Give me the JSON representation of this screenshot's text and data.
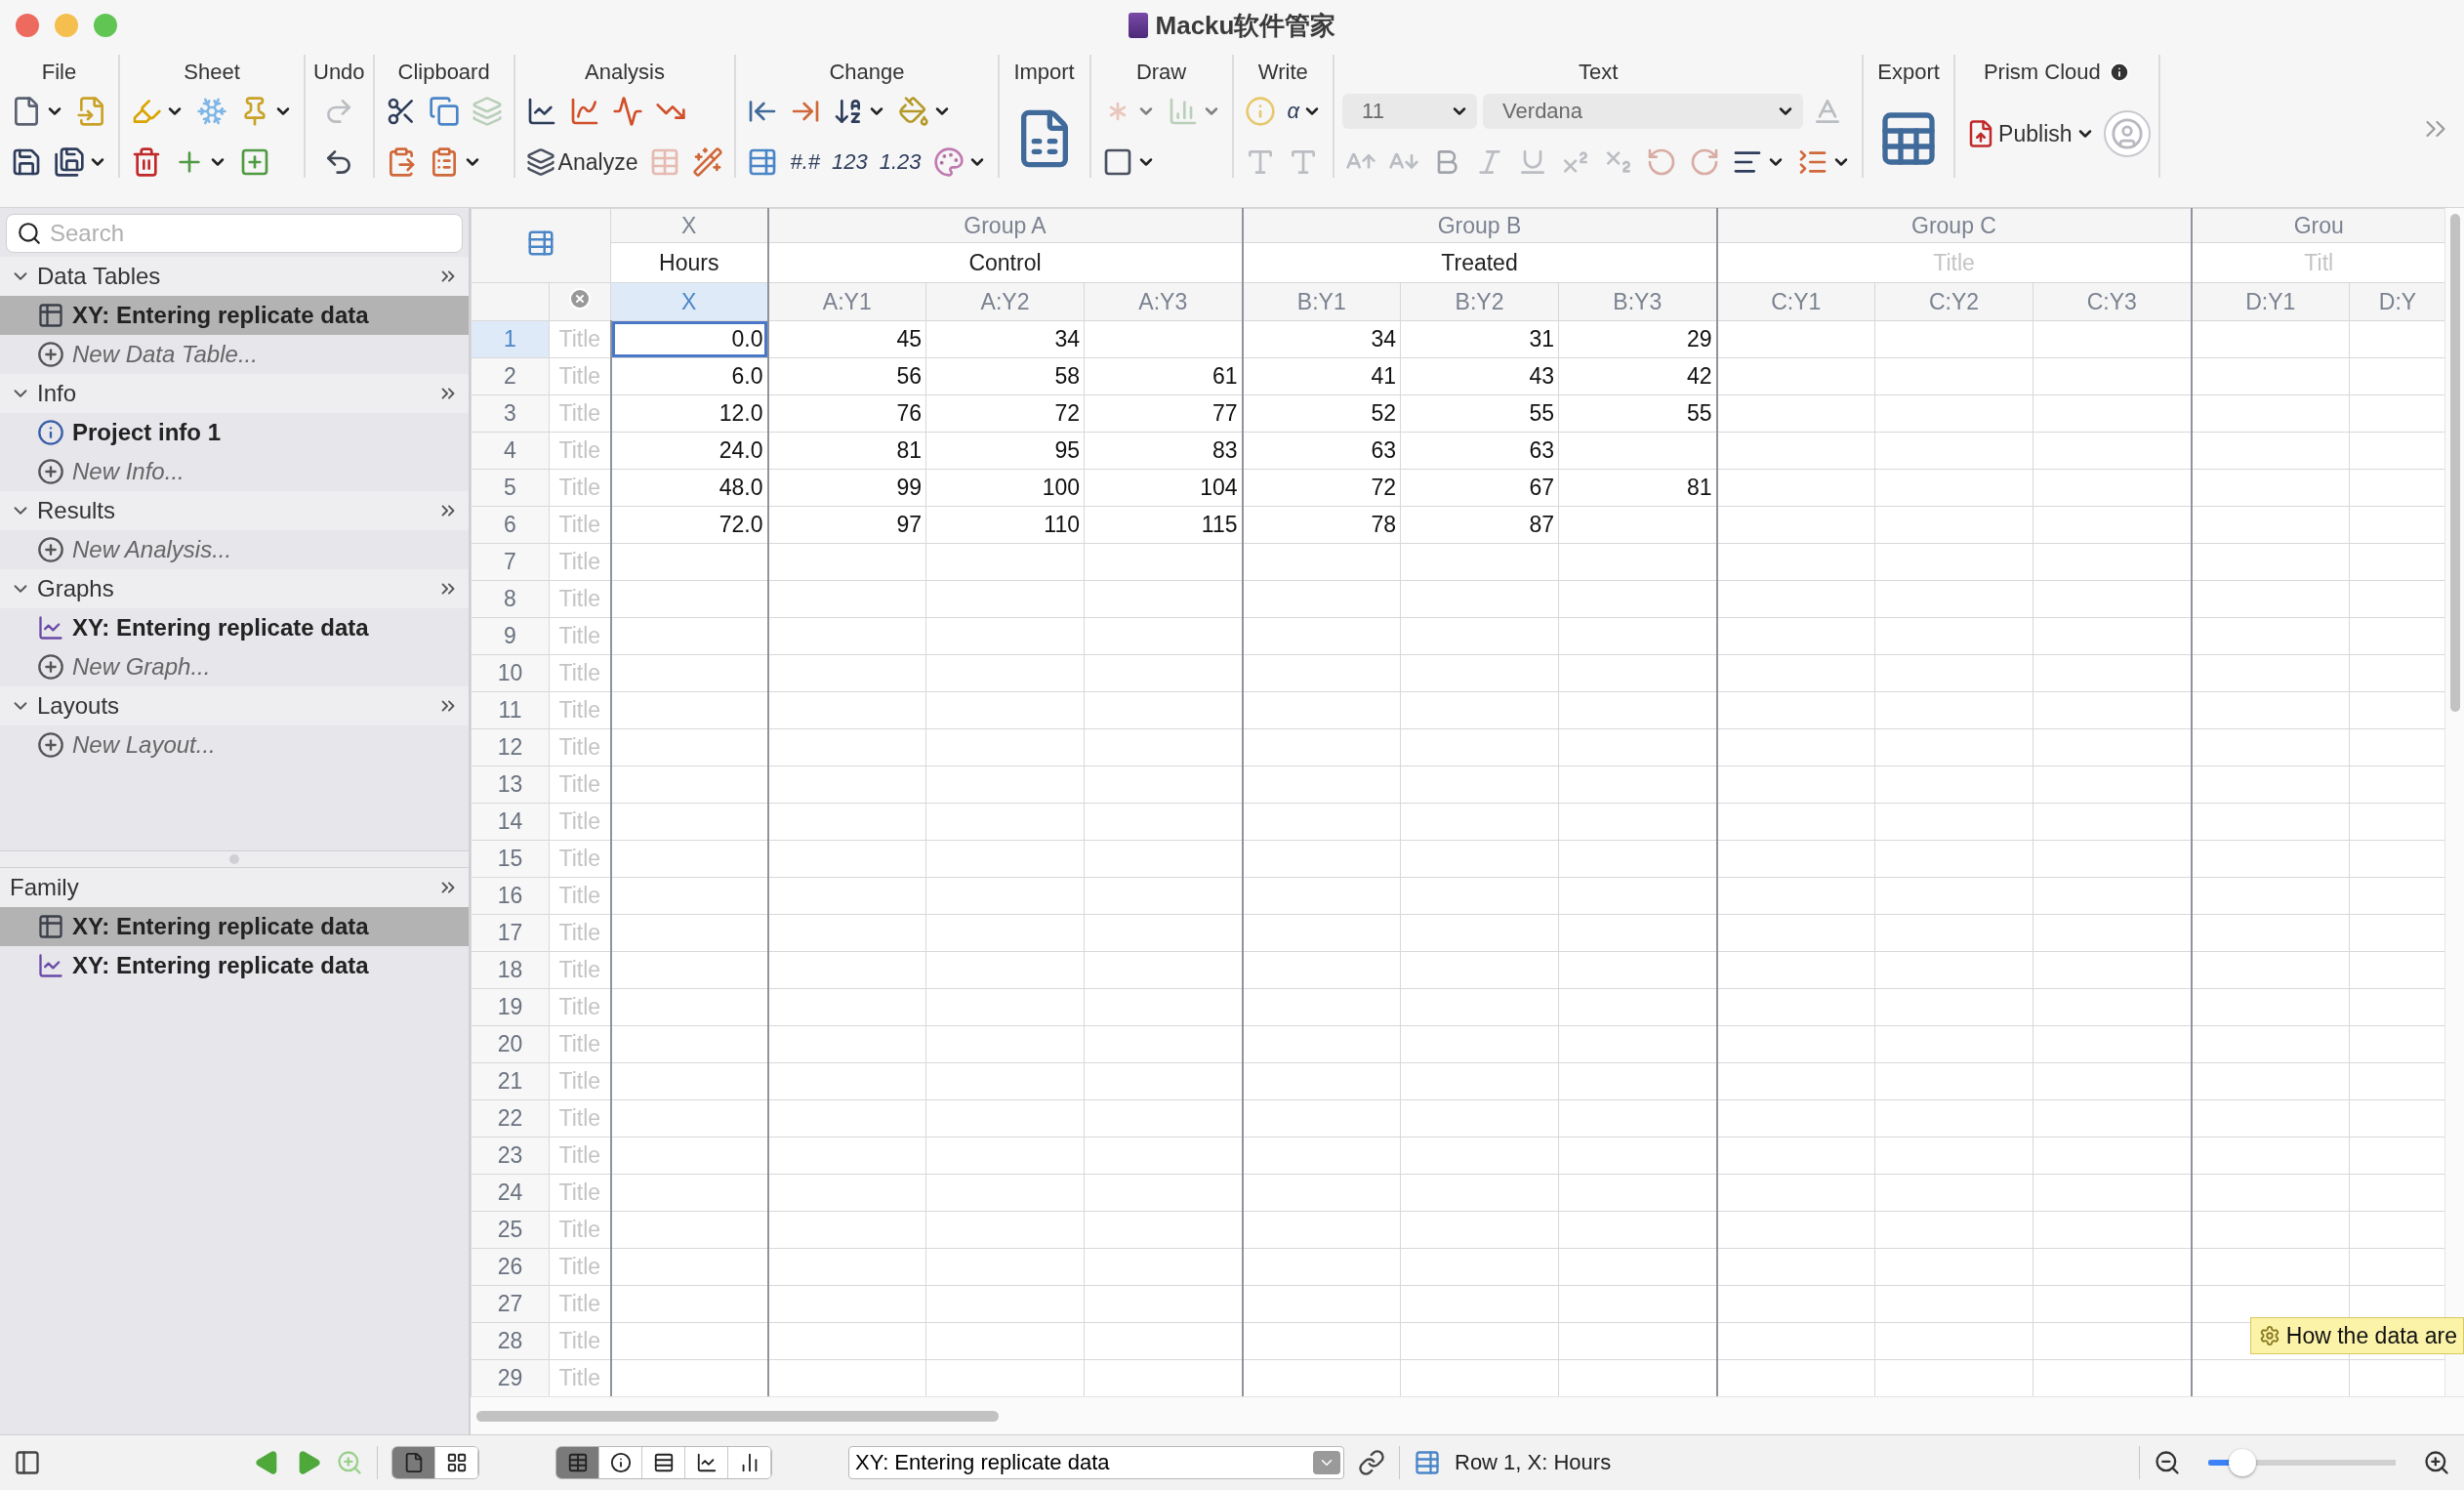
{
  "window": {
    "title": "Macku软件管家"
  },
  "toolbar": {
    "groups": [
      {
        "label": "File",
        "rows": [
          [
            {
              "kind": "icon",
              "dropdown": true,
              "disabled": false
            },
            {
              "kind": "icon",
              "dropdown": false,
              "disabled": false
            }
          ],
          [
            {
              "kind": "icon",
              "dropdown": false,
              "disabled": false
            },
            {
              "kind": "icon",
              "dropdown": true,
              "disabled": false
            }
          ]
        ]
      },
      {
        "label": "Sheet",
        "rows": [
          [
            {
              "kind": "icon",
              "dropdown": true,
              "disabled": false
            },
            {
              "kind": "icon",
              "dropdown": false,
              "disabled": false
            },
            {
              "kind": "icon",
              "dropdown": true,
              "disabled": false
            }
          ],
          [
            {
              "kind": "icon",
              "dropdown": false,
              "disabled": false
            },
            {
              "kind": "icon",
              "dropdown": true,
              "disabled": false
            },
            {
              "kind": "icon",
              "dropdown": false,
              "disabled": false
            }
          ]
        ]
      },
      {
        "label": "Undo",
        "rows": [
          [
            {
              "kind": "icon",
              "dropdown": false,
              "disabled": true
            }
          ],
          [
            {
              "kind": "icon",
              "dropdown": false,
              "disabled": false
            }
          ]
        ]
      },
      {
        "label": "Clipboard",
        "rows": [
          [
            {
              "kind": "icon",
              "dropdown": false,
              "disabled": false
            },
            {
              "kind": "icon",
              "dropdown": false,
              "disabled": false
            },
            {
              "kind": "icon",
              "dropdown": false,
              "disabled": true
            }
          ],
          [
            {
              "kind": "icon",
              "dropdown": false,
              "disabled": false
            },
            {
              "kind": "icon",
              "dropdown": true,
              "disabled": false
            }
          ]
        ]
      },
      {
        "label": "Analysis",
        "rows": [
          [
            {
              "kind": "icon",
              "dropdown": false,
              "disabled": false
            },
            {
              "kind": "icon",
              "dropdown": false,
              "disabled": false
            },
            {
              "kind": "icon",
              "dropdown": false,
              "disabled": false
            },
            {
              "kind": "icon",
              "dropdown": false,
              "disabled": false
            }
          ],
          [
            {
              "kind": "labeled",
              "text": "Analyze",
              "dropdown": false,
              "disabled": false
            },
            {
              "kind": "icon",
              "dropdown": false,
              "disabled": true
            },
            {
              "kind": "icon",
              "dropdown": false,
              "disabled": false
            }
          ]
        ]
      },
      {
        "label": "Change",
        "rows": [
          [
            {
              "kind": "icon",
              "dropdown": false,
              "disabled": false
            },
            {
              "kind": "icon",
              "dropdown": false,
              "disabled": false
            },
            {
              "kind": "icon",
              "dropdown": true,
              "disabled": false
            },
            {
              "kind": "icon",
              "dropdown": true,
              "disabled": false
            }
          ],
          [
            {
              "kind": "icon",
              "dropdown": false,
              "disabled": false
            },
            {
              "kind": "glyph",
              "text": "#.#",
              "dropdown": false,
              "disabled": false
            },
            {
              "kind": "glyph",
              "text": "123",
              "dropdown": false,
              "disabled": false
            },
            {
              "kind": "glyph",
              "text": "1.23",
              "dropdown": false,
              "disabled": false
            },
            {
              "kind": "icon",
              "dropdown": true,
              "disabled": false
            }
          ]
        ]
      },
      {
        "label": "Import",
        "rows": [
          [
            {
              "kind": "large",
              "dropdown": false,
              "disabled": false
            }
          ]
        ]
      },
      {
        "label": "Draw",
        "rows": [
          [
            {
              "kind": "icon",
              "dropdown": true,
              "disabled": true
            },
            {
              "kind": "icon",
              "dropdown": true,
              "disabled": true
            }
          ],
          [
            {
              "kind": "icon",
              "dropdown": true,
              "disabled": false
            }
          ]
        ]
      },
      {
        "label": "Write",
        "rows": [
          [
            {
              "kind": "icon",
              "dropdown": false,
              "disabled": true
            },
            {
              "kind": "glyph",
              "text": "α",
              "dropdown": true,
              "disabled": false
            }
          ],
          [
            {
              "kind": "icon",
              "dropdown": false,
              "disabled": true
            },
            {
              "kind": "icon",
              "dropdown": false,
              "disabled": true
            }
          ]
        ]
      },
      {
        "label": "Text",
        "rows": [
          [
            {
              "kind": "select",
              "text": "11",
              "dropdown": true,
              "disabled": true
            },
            {
              "kind": "select",
              "text": "Verdana",
              "dropdown": true,
              "disabled": true
            },
            {
              "kind": "icon",
              "dropdown": false,
              "disabled": true
            }
          ],
          [
            {
              "kind": "icon",
              "dropdown": false,
              "disabled": true
            },
            {
              "kind": "icon",
              "dropdown": false,
              "disabled": true
            },
            {
              "kind": "icon",
              "dropdown": false,
              "disabled": true
            },
            {
              "kind": "icon",
              "dropdown": false,
              "disabled": true
            },
            {
              "kind": "icon",
              "dropdown": false,
              "disabled": true
            },
            {
              "kind": "icon",
              "dropdown": false,
              "disabled": true
            },
            {
              "kind": "icon",
              "dropdown": false,
              "disabled": true
            },
            {
              "kind": "icon",
              "dropdown": false,
              "disabled": true
            },
            {
              "kind": "icon",
              "dropdown": false,
              "disabled": true
            },
            {
              "kind": "icon",
              "dropdown": true,
              "disabled": false
            },
            {
              "kind": "icon",
              "dropdown": true,
              "disabled": false
            }
          ]
        ]
      },
      {
        "label": "Export",
        "rows": [
          [
            {
              "kind": "large",
              "dropdown": false,
              "disabled": false
            }
          ]
        ]
      },
      {
        "label": "Prism Cloud",
        "rows": [
          [
            {
              "kind": "labeled",
              "text": "Publish",
              "dropdown": true,
              "disabled": false
            },
            {
              "kind": "avatar",
              "dropdown": false,
              "disabled": false
            }
          ]
        ]
      }
    ]
  },
  "sidebar": {
    "search": {
      "placeholder": "Search"
    },
    "sections": [
      {
        "title": "Data Tables",
        "expanded": true,
        "items": [
          {
            "kind": "table",
            "label": "XY: Entering replicate data",
            "selected": true
          },
          {
            "kind": "new",
            "label": "New Data Table...",
            "selected": false
          }
        ]
      },
      {
        "title": "Info",
        "expanded": true,
        "items": [
          {
            "kind": "info",
            "label": "Project info 1",
            "selected": false
          },
          {
            "kind": "new",
            "label": "New Info...",
            "selected": false
          }
        ]
      },
      {
        "title": "Results",
        "expanded": true,
        "items": [
          {
            "kind": "new",
            "label": "New Analysis...",
            "selected": false
          }
        ]
      },
      {
        "title": "Graphs",
        "expanded": true,
        "items": [
          {
            "kind": "graph",
            "label": "XY: Entering replicate data",
            "selected": false
          },
          {
            "kind": "new",
            "label": "New Graph...",
            "selected": false
          }
        ]
      },
      {
        "title": "Layouts",
        "expanded": true,
        "items": [
          {
            "kind": "new",
            "label": "New Layout...",
            "selected": false
          }
        ]
      }
    ],
    "family": {
      "title": "Family",
      "items": [
        {
          "kind": "table",
          "label": "XY: Entering replicate data",
          "selected": true
        },
        {
          "kind": "graph",
          "label": "XY: Entering replicate data",
          "selected": false
        }
      ]
    }
  },
  "table": {
    "groups": [
      {
        "title": "X",
        "subtitle": "Hours",
        "columns": [
          {
            "label": "X",
            "selected": true
          }
        ]
      },
      {
        "title": "Group A",
        "subtitle": "Control",
        "columns": [
          {
            "label": "A:Y1",
            "selected": false
          },
          {
            "label": "A:Y2",
            "selected": false
          },
          {
            "label": "A:Y3",
            "selected": false
          }
        ]
      },
      {
        "title": "Group B",
        "subtitle": "Treated",
        "columns": [
          {
            "label": "B:Y1",
            "selected": false
          },
          {
            "label": "B:Y2",
            "selected": false
          },
          {
            "label": "B:Y3",
            "selected": false
          }
        ]
      },
      {
        "title": "Group C",
        "subtitle_placeholder": "Title",
        "columns": [
          {
            "label": "C:Y1",
            "selected": false
          },
          {
            "label": "C:Y2",
            "selected": false
          },
          {
            "label": "C:Y3",
            "selected": false
          }
        ]
      },
      {
        "title": "Grou",
        "subtitle_placeholder": "Titl",
        "columns": [
          {
            "label": "D:Y1",
            "selected": false
          },
          {
            "label": "D:Y",
            "selected": false
          }
        ]
      }
    ],
    "rows": [
      {
        "number": "1",
        "title_placeholder": "Title",
        "selected": true,
        "cells": [
          "0.0",
          "45",
          "34",
          null,
          "34",
          "31",
          "29"
        ]
      },
      {
        "number": "2",
        "title_placeholder": "Title",
        "selected": false,
        "cells": [
          "6.0",
          "56",
          "58",
          "61",
          "41",
          "43",
          "42"
        ]
      },
      {
        "number": "3",
        "title_placeholder": "Title",
        "selected": false,
        "cells": [
          "12.0",
          "76",
          "72",
          "77",
          "52",
          "55",
          "55"
        ]
      },
      {
        "number": "4",
        "title_placeholder": "Title",
        "selected": false,
        "cells": [
          "24.0",
          "81",
          "95",
          "83",
          "63",
          "63"
        ]
      },
      {
        "number": "5",
        "title_placeholder": "Title",
        "selected": false,
        "cells": [
          "48.0",
          "99",
          "100",
          "104",
          "72",
          "67",
          "81"
        ]
      },
      {
        "number": "6",
        "title_placeholder": "Title",
        "selected": false,
        "cells": [
          "72.0",
          "97",
          "110",
          "115",
          "78",
          "87"
        ]
      },
      {
        "number": "7",
        "title_placeholder": "Title",
        "selected": false
      },
      {
        "number": "8",
        "title_placeholder": "Title",
        "selected": false
      },
      {
        "number": "9",
        "title_placeholder": "Title",
        "selected": false
      },
      {
        "number": "10",
        "title_placeholder": "Title",
        "selected": false
      },
      {
        "number": "11",
        "title_placeholder": "Title",
        "selected": false
      },
      {
        "number": "12",
        "title_placeholder": "Title",
        "selected": false
      },
      {
        "number": "13",
        "title_placeholder": "Title",
        "selected": false
      },
      {
        "number": "14",
        "title_placeholder": "Title",
        "selected": false
      },
      {
        "number": "15",
        "title_placeholder": "Title",
        "selected": false
      },
      {
        "number": "16",
        "title_placeholder": "Title",
        "selected": false
      },
      {
        "number": "17",
        "title_placeholder": "Title",
        "selected": false
      },
      {
        "number": "18",
        "title_placeholder": "Title",
        "selected": false
      },
      {
        "number": "19",
        "title_placeholder": "Title",
        "selected": false
      },
      {
        "number": "20",
        "title_placeholder": "Title",
        "selected": false
      },
      {
        "number": "21",
        "title_placeholder": "Title",
        "selected": false
      },
      {
        "number": "22",
        "title_placeholder": "Title",
        "selected": false
      },
      {
        "number": "23",
        "title_placeholder": "Title",
        "selected": false
      },
      {
        "number": "24",
        "title_placeholder": "Title",
        "selected": false
      },
      {
        "number": "25",
        "title_placeholder": "Title",
        "selected": false
      },
      {
        "number": "26",
        "title_placeholder": "Title",
        "selected": false
      },
      {
        "number": "27",
        "title_placeholder": "Title",
        "selected": false
      },
      {
        "number": "28",
        "title_placeholder": "Title",
        "selected": false
      },
      {
        "number": "29",
        "title_placeholder": "Title",
        "selected": false
      }
    ]
  },
  "hint": {
    "text": "How the data are"
  },
  "status_bar": {
    "view_buttons": [
      {
        "selected": true
      },
      {
        "selected": false
      }
    ],
    "sheet_tabs": [
      {
        "selected": true
      },
      {
        "selected": false
      },
      {
        "selected": false
      },
      {
        "selected": false
      },
      {
        "selected": false
      }
    ],
    "sheet_select": {
      "value": "XY: Entering replicate data"
    },
    "status": "Row 1, X: Hours",
    "zoom": {
      "level": 0.18
    }
  }
}
